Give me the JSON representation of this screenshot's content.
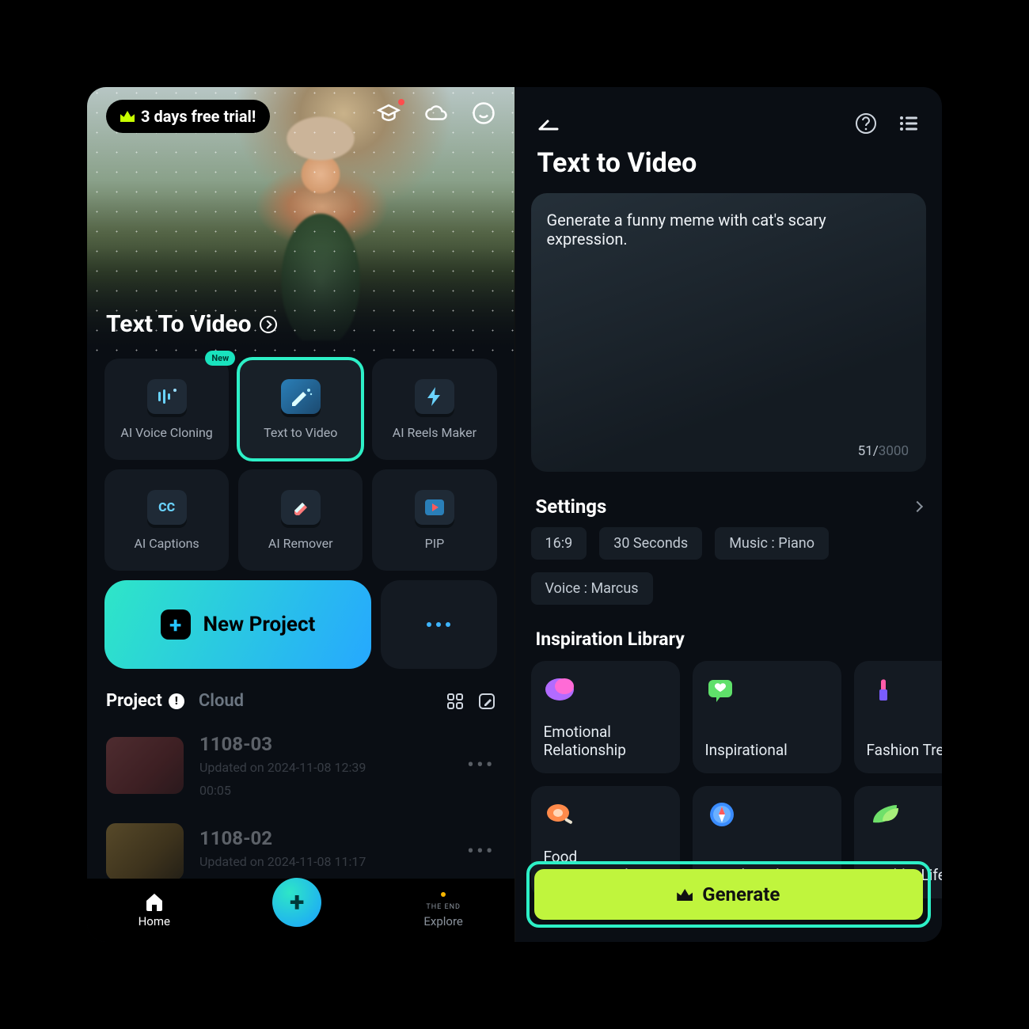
{
  "left": {
    "trial_label": "3 days free trial!",
    "hero_title": "Text To Video",
    "tools": [
      {
        "label": "AI Voice Cloning",
        "badge": "New"
      },
      {
        "label": "Text  to Video"
      },
      {
        "label": "AI Reels Maker"
      },
      {
        "label": "AI Captions"
      },
      {
        "label": "AI Remover"
      },
      {
        "label": "PIP"
      }
    ],
    "new_project_label": "New Project",
    "tabs": {
      "project": "Project",
      "cloud": "Cloud"
    },
    "projects": [
      {
        "title": "1108-03",
        "subtitle": "Updated on 2024-11-08 12:39",
        "duration": "00:05"
      },
      {
        "title": "1108-02",
        "subtitle": "Updated on 2024-11-08 11:17",
        "duration": ""
      }
    ],
    "nav": {
      "home": "Home",
      "explore": "Explore"
    }
  },
  "right": {
    "title": "Text to Video",
    "prompt_text": "Generate a funny meme with cat's scary expression.",
    "char_count": "51",
    "char_max": "3000",
    "settings_label": "Settings",
    "chips": [
      "16:9",
      "30 Seconds",
      "Music : Piano",
      "Voice : Marcus"
    ],
    "inspiration_label": "Inspiration Library",
    "inspiration": [
      "Emotional Relationship",
      "Inspirational",
      "Fashion Trend",
      "Food Recommendation",
      "Travel Guide",
      "Healthy Lifestyle"
    ],
    "generate_label": "Generate"
  }
}
